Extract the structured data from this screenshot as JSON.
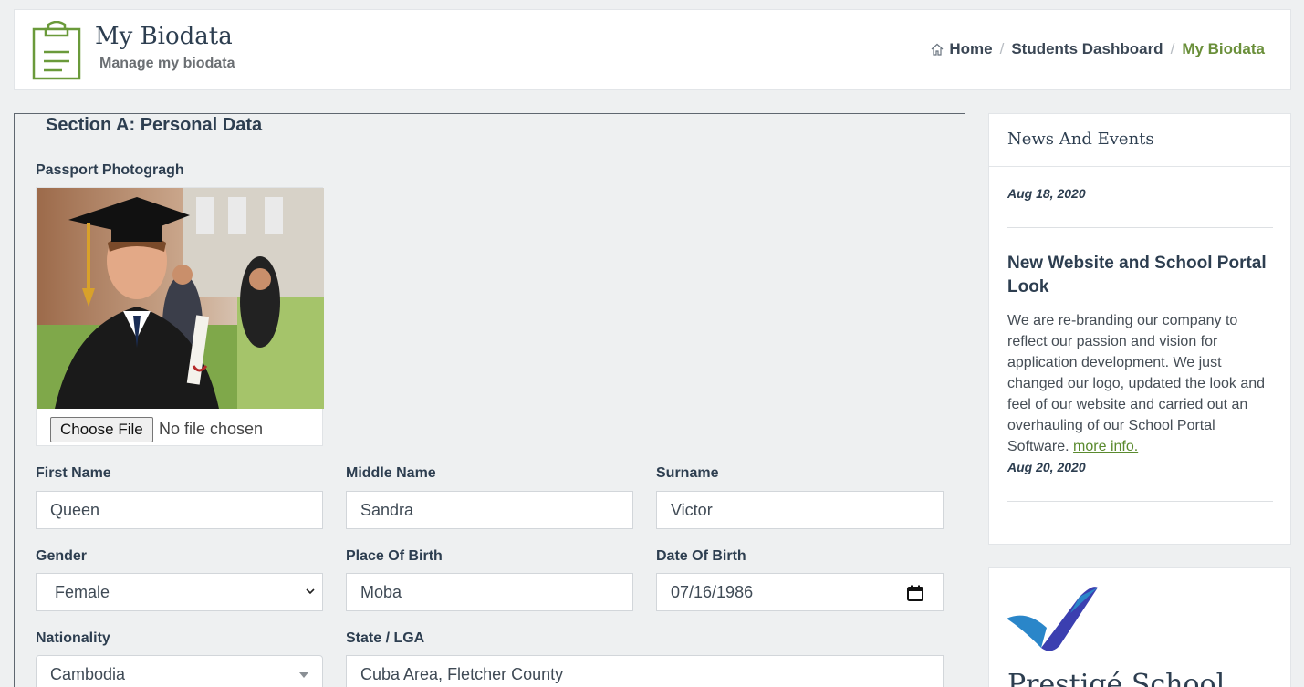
{
  "header": {
    "title": "My Biodata",
    "subtitle": "Manage my biodata",
    "breadcrumb": [
      "Home",
      "Students Dashboard",
      "My Biodata"
    ],
    "accent_color": "#6a8f3a"
  },
  "form": {
    "section_title": "Section A: Personal Data",
    "passport_label": "Passport Photogragh",
    "choose_file_label": "Choose File",
    "no_file_text": "No file chosen",
    "first_name_label": "First Name",
    "first_name_value": "Queen",
    "middle_name_label": "Middle Name",
    "middle_name_value": "Sandra",
    "surname_label": "Surname",
    "surname_value": "Victor",
    "gender_label": "Gender",
    "gender_value": "Female",
    "place_of_birth_label": "Place Of Birth",
    "place_of_birth_value": "Moba",
    "date_of_birth_label": "Date Of Birth",
    "date_of_birth_value": "07/16/1986",
    "nationality_label": "Nationality",
    "nationality_value": "Cambodia",
    "state_lga_label": "State / LGA",
    "state_lga_value": "Cuba Area, Fletcher County"
  },
  "news": {
    "heading": "News And Events",
    "date1": "Aug 18, 2020",
    "item_title": "New Website and School Portal Look",
    "item_body": "We are re-branding our company to reflect our passion and vision for application development. We just changed our logo, updated the look and feel of our website and carried out an overhauling of our School Portal Software.",
    "more_link": "more info.",
    "date2": "Aug 20, 2020"
  },
  "logo_card": {
    "text": "Prestigé School"
  }
}
